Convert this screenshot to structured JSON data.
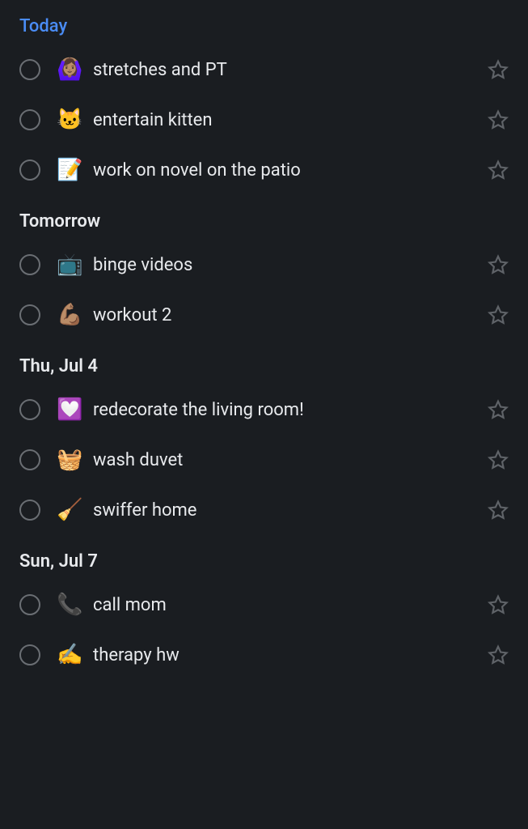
{
  "sections": [
    {
      "title": "Today",
      "accent": true,
      "tasks": [
        {
          "emoji": "🙆🏽‍♀️",
          "label": "stretches and PT"
        },
        {
          "emoji": "🐱",
          "label": "entertain kitten"
        },
        {
          "emoji": "📝",
          "label": "work on novel on the patio"
        }
      ]
    },
    {
      "title": "Tomorrow",
      "accent": false,
      "tasks": [
        {
          "emoji": "📺",
          "label": "binge videos"
        },
        {
          "emoji": "💪🏽",
          "label": "workout 2"
        }
      ]
    },
    {
      "title": "Thu, Jul 4",
      "accent": false,
      "tasks": [
        {
          "emoji": "💟",
          "label": "redecorate the living room!"
        },
        {
          "emoji": "🧺",
          "label": "wash duvet"
        },
        {
          "emoji": "🧹",
          "label": "swiffer home"
        }
      ]
    },
    {
      "title": "Sun, Jul 7",
      "accent": false,
      "tasks": [
        {
          "emoji": "📞",
          "label": "call mom"
        },
        {
          "emoji": "✍️",
          "label": "therapy hw"
        }
      ]
    }
  ]
}
